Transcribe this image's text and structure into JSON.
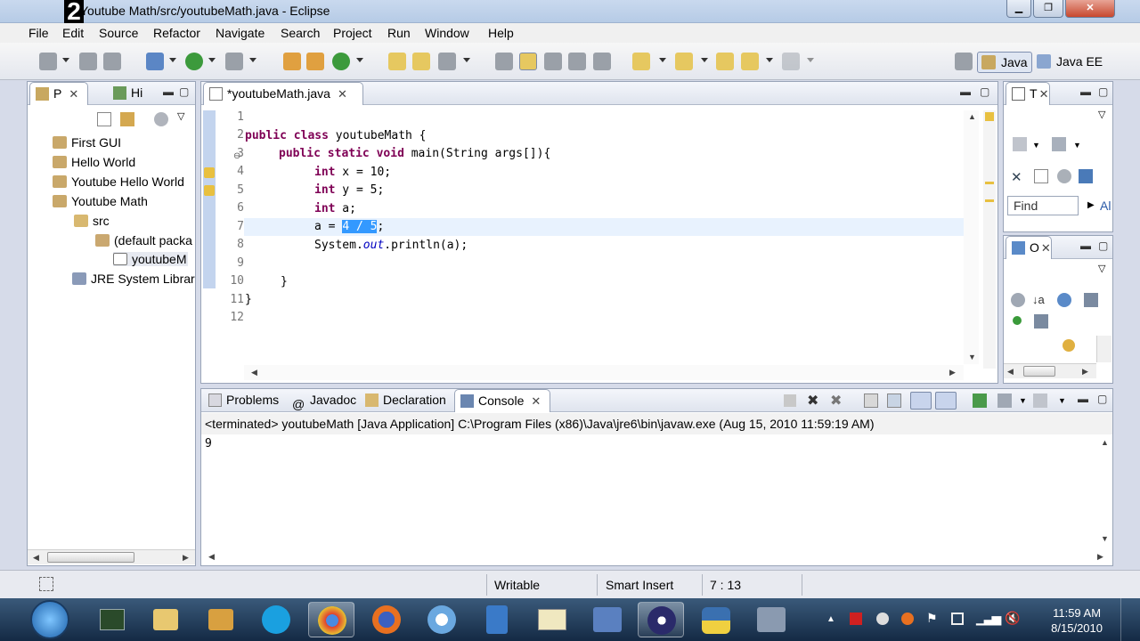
{
  "window": {
    "title": "Youtube Math/src/youtubeMath.java - Eclipse",
    "overlay_digit": "2"
  },
  "menu": [
    "File",
    "Edit",
    "Source",
    "Refactor",
    "Navigate",
    "Search",
    "Project",
    "Run",
    "Window",
    "Help"
  ],
  "perspectives": {
    "java": "Java",
    "javaee": "Java EE"
  },
  "package_explorer": {
    "tab_p": "P",
    "tab_hi": "Hi",
    "items": [
      "First GUI",
      "Hello World",
      "Youtube Hello World",
      "Youtube Math",
      "src",
      "(default packa",
      "youtubeM",
      "JRE System Librar"
    ]
  },
  "editor": {
    "tab": "*youtubeMath.java",
    "line_numbers": [
      "1",
      "2",
      "3",
      "4",
      "5",
      "6",
      "7",
      "8",
      "9",
      "10",
      "11",
      "12"
    ],
    "code": {
      "l2a": "public",
      "l2b": "class",
      "l2c": " youtubeMath {",
      "l3a": "public",
      "l3b": "static",
      "l3c": "void",
      "l3d": " main(String args[]){",
      "l4a": "int",
      "l4b": " x = 10;",
      "l5a": "int",
      "l5b": " y = 5;",
      "l6a": "int",
      "l6b": " a;",
      "l7a": "a = ",
      "l7sel": "4 / 5",
      "l7b": ";",
      "l8a": "System.",
      "l8b": "out",
      "l8c": ".println(a);",
      "l10": "}",
      "l11": "}"
    }
  },
  "right_views": {
    "t_tab": "T",
    "find_placeholder": "Find",
    "all_label": "Al",
    "o_tab": "O"
  },
  "bottom": {
    "tabs": [
      "Problems",
      "Javadoc",
      "Declaration",
      "Console"
    ],
    "console_header": "<terminated> youtubeMath [Java Application] C:\\Program Files (x86)\\Java\\jre6\\bin\\javaw.exe (Aug 15, 2010 11:59:19 AM)",
    "console_output": "9"
  },
  "status": {
    "writable": "Writable",
    "insert_mode": "Smart Insert",
    "position": "7 : 13"
  },
  "taskbar": {
    "time": "11:59 AM",
    "date": "8/15/2010"
  },
  "colors": {
    "keyword": "#7f0055",
    "field": "#0000c0",
    "selection": "#3399ff"
  }
}
